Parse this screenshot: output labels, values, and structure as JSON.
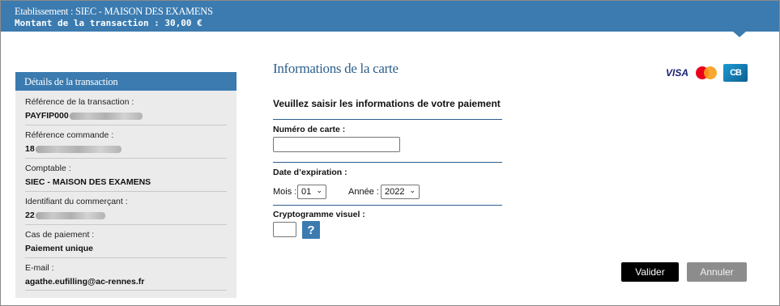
{
  "header": {
    "etablissement": "Etablissement : SIEC - MAISON DES EXAMENS",
    "montant": "Montant de la transaction  :  30,00 €",
    "color": "#3b7bb0"
  },
  "sidebar": {
    "title": "Détails de la transaction",
    "items": [
      {
        "label": "Référence de la transaction :",
        "value": "PAYFIP000"
      },
      {
        "label": "Référence commande :",
        "value": "18"
      },
      {
        "label": "Comptable :",
        "value": "SIEC - MAISON DES EXAMENS"
      },
      {
        "label": "Identifiant du commerçant :",
        "value": "22"
      },
      {
        "label": "Cas de paiement :",
        "value": "Paiement unique"
      },
      {
        "label": "E-mail :",
        "value": "agathe.eufilling@ac-rennes.fr"
      }
    ]
  },
  "main": {
    "title": "Informations de la carte",
    "subtitle": "Veuillez saisir les informations de votre paiement",
    "card_number_label": "Numéro de carte :",
    "card_number_value": "",
    "expiry_label": "Date d’expiration :",
    "month_label": "Mois :",
    "month_value": "01",
    "year_label": "Année :",
    "year_value": "2022",
    "cvv_label": "Cryptogramme visuel :",
    "cvv_value": "",
    "help_symbol": "?"
  },
  "logos": {
    "visa": "VISA",
    "cb": "CB",
    "icons": [
      "visa-logo",
      "mastercard-logo",
      "cb-logo"
    ]
  },
  "buttons": {
    "validate": "Valider",
    "cancel": "Annuler"
  }
}
